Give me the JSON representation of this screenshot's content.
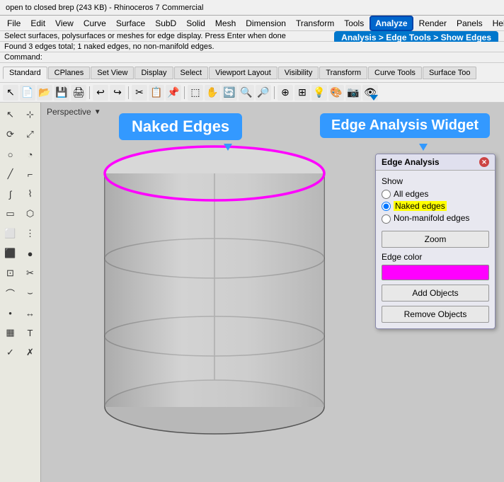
{
  "titlebar": {
    "text": "open to closed brep (243 KB) - Rhinoceros 7 Commercial"
  },
  "menubar": {
    "items": [
      "File",
      "Edit",
      "View",
      "Curve",
      "Surface",
      "SubD",
      "Solid",
      "Mesh",
      "Dimension",
      "Transform",
      "Tools",
      "Analyze",
      "Render",
      "Panels",
      "Help"
    ],
    "active": "Analyze"
  },
  "statusbar": {
    "line1": "Select surfaces, polysurfaces or meshes for edge display. Press Enter when done",
    "line2": "Found 3 edges total; 1 naked edges, no non-manifold edges.",
    "command_label": "Command:",
    "breadcrumb": "Analysis > Edge Tools > Show Edges"
  },
  "toolbar_tabs": [
    "Standard",
    "CPlanes",
    "Set View",
    "Display",
    "Select",
    "Viewport Layout",
    "Visibility",
    "Transform",
    "Curve Tools",
    "Surface Too"
  ],
  "viewport": {
    "label": "Perspective",
    "dropdown": "▼"
  },
  "naked_edges": {
    "label": "Naked Edges",
    "widget_label": "Edge Analysis Widget"
  },
  "edge_panel": {
    "title": "Edge Analysis",
    "close": "✕",
    "show_label": "Show",
    "radio_all": "All edges",
    "radio_naked": "Naked edges",
    "radio_nonmanifold": "Non-manifold edges",
    "zoom_btn": "Zoom",
    "edge_color_label": "Edge color",
    "add_objects_btn": "Add Objects",
    "remove_objects_btn": "Remove Objects",
    "selected_radio": "naked"
  },
  "colors": {
    "naked_edge": "#ff00ff",
    "label_bg": "#3399ff",
    "breadcrumb_bg": "#0077cc",
    "panel_close": "#cc4444"
  }
}
